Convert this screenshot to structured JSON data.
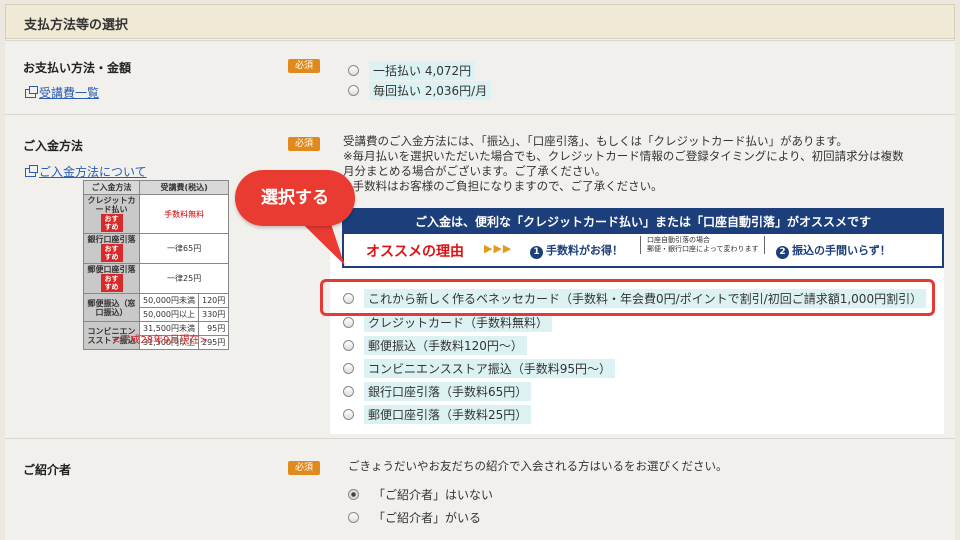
{
  "header": {
    "title": "支払方法等の選択"
  },
  "payment": {
    "label": "お支払い方法・金額",
    "required": "必須",
    "link": "受講費一覧",
    "options": [
      "一括払い 4,072円",
      "毎回払い 2,036円/月"
    ]
  },
  "deposit": {
    "label": "ご入金方法",
    "required": "必須",
    "link": "ご入金方法について",
    "desc_lines": [
      "受講費のご入金方法には、「振込」、「口座引落」、もしくは「クレジットカード払い」があります。",
      "※毎月払いを選択いただいた場合でも、クレジットカード情報のご登録タイミングにより、初回請求分は複数",
      "月分まとめる場合がございます。ご了承ください。",
      "※手数料はお客様のご負担になりますので、ご了承ください。"
    ],
    "banner": {
      "top": "ご入金は、便利な「クレジットカード払い」または「口座自動引落」がオススメです",
      "reason_title": "オススメの理由",
      "arrows": "▶▶▶",
      "reason1_num": "1",
      "reason1": "手数料がお得！",
      "reason1_note_1": "口座自動引落の場合",
      "reason1_note_2": "郵便・銀行口座によって変わります",
      "reason2_num": "2",
      "reason2": "振込の手間いらず！"
    },
    "options": [
      "これから新しく作るベネッセカード（手数料・年会費0円/ポイントで割引/初回ご請求額1,000円割引）",
      "クレジットカード（手数料無料）",
      "郵便振込（手数料120円〜）",
      "コンビニエンスストア振込（手数料95円〜）",
      "銀行口座引落（手数料65円）",
      "郵便口座引落（手数料25円）"
    ],
    "callout": "選択する",
    "table": {
      "headers": [
        "ご入金方法",
        "受講費(税込)"
      ],
      "osusume": "おすすめ",
      "rows": {
        "credit": {
          "method": "クレジットカード払い",
          "fee": "手数料無料"
        },
        "bank": {
          "method": "銀行口座引落",
          "fee": "一律65円"
        },
        "postal": {
          "method": "郵便口座引落",
          "fee": "一律25円"
        },
        "postal_transfer": {
          "method": "郵便振込（窓口振込）",
          "r1_cond": "50,000円未満",
          "r1_fee": "120円",
          "r2_cond": "50,000円以上",
          "r2_fee": "330円"
        },
        "convenience": {
          "method": "コンビニエンスストア振込",
          "r1_cond": "31,500円未満",
          "r1_fee": "95円",
          "r2_cond": "31,500円以上",
          "r2_fee": "295円"
        }
      },
      "caption": "<平成28年9月現在>"
    }
  },
  "referral": {
    "label": "ご紹介者",
    "required": "必須",
    "desc": "ごきょうだいやお友だちの紹介で入会される方はいるをお選びください。",
    "options": [
      "「ご紹介者」はいない",
      "「ご紹介者」がいる"
    ],
    "selected_index": 0
  },
  "colors": {
    "accent": "#e08a1e",
    "banner": "#1c3e7a",
    "highlight": "#e53935"
  }
}
